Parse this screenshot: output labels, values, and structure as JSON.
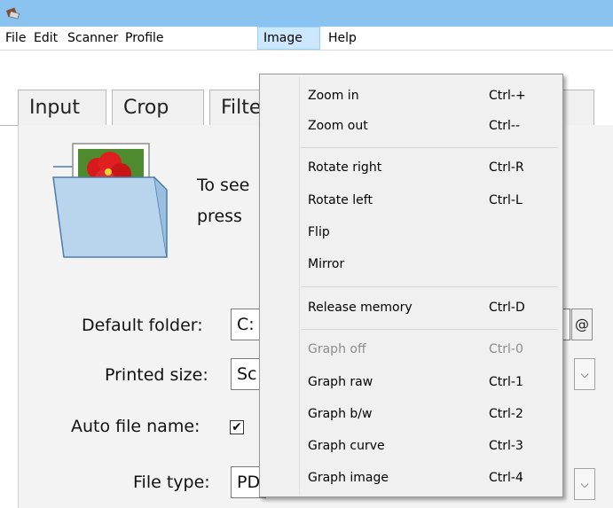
{
  "menubar": {
    "items": [
      "File",
      "Edit",
      "Scanner",
      "Profile",
      "Image",
      "Help"
    ]
  },
  "tabs": [
    "Input",
    "Crop",
    "Filte"
  ],
  "intro_text": "To see\npress",
  "form": {
    "default_folder_label": "Default folder:",
    "default_folder_value": "C:",
    "at_button": "@",
    "printed_size_label": "Printed size:",
    "printed_size_value": "Sc",
    "auto_file_name_label": "Auto file name:",
    "auto_file_name_checked": "✔",
    "file_type_label": "File type:",
    "file_type_value": "PD"
  },
  "image_menu": {
    "zoom_in": {
      "label": "Zoom in",
      "shortcut": "Ctrl-+"
    },
    "zoom_out": {
      "label": "Zoom out",
      "shortcut": "Ctrl--"
    },
    "rotate_right": {
      "label": "Rotate right",
      "shortcut": "Ctrl-R"
    },
    "rotate_left": {
      "label": "Rotate left",
      "shortcut": "Ctrl-L"
    },
    "flip": {
      "label": "Flip",
      "shortcut": ""
    },
    "mirror": {
      "label": "Mirror",
      "shortcut": ""
    },
    "release_memory": {
      "label": "Release memory",
      "shortcut": "Ctrl-D"
    },
    "graph_off": {
      "label": "Graph off",
      "shortcut": "Ctrl-0"
    },
    "graph_raw": {
      "label": "Graph raw",
      "shortcut": "Ctrl-1"
    },
    "graph_bw": {
      "label": "Graph b/w",
      "shortcut": "Ctrl-2"
    },
    "graph_curve": {
      "label": "Graph curve",
      "shortcut": "Ctrl-3"
    },
    "graph_image": {
      "label": "Graph image",
      "shortcut": "Ctrl-4"
    }
  },
  "colors": {
    "titlebar": "#8bc3f0",
    "menu_highlight": "#cce8ff",
    "panel": "#f3f3f3"
  }
}
